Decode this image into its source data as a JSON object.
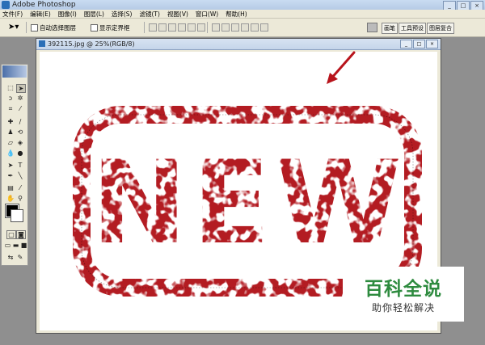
{
  "app": {
    "title": "Adobe Photoshop"
  },
  "menu": [
    "文件(F)",
    "编辑(E)",
    "图像(I)",
    "图层(L)",
    "选择(S)",
    "滤镜(T)",
    "视图(V)",
    "窗口(W)",
    "帮助(H)"
  ],
  "options": {
    "auto_select_layer": "自动选择图层",
    "show_bounding_box": "显示定界框"
  },
  "palette_well": [
    "画笔",
    "工具预设",
    "图层复合"
  ],
  "document": {
    "title": "392115.jpg @ 25%(RGB/8)"
  },
  "stamp": {
    "text": "NEW",
    "color": "#b31b22"
  },
  "watermark": {
    "line1": "百科全说",
    "line2": "助你轻松解决",
    "color": "#2e8b3f"
  },
  "window_controls": {
    "minimize": "_",
    "maximize": "□",
    "close": "×"
  }
}
